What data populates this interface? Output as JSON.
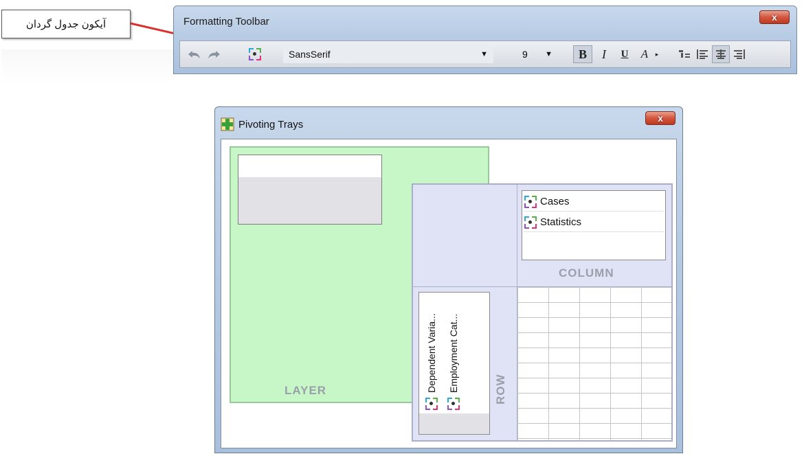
{
  "callout": {
    "text": "آیکون جدول گردان"
  },
  "formatting_toolbar": {
    "title": "Formatting Toolbar",
    "close_glyph": "x",
    "undo_icon": "undo-icon",
    "redo_icon": "redo-icon",
    "pivot_icon": "pivoting-trays-icon",
    "font_family": "SansSerif",
    "font_size": "9",
    "bold_label": "B",
    "italic_label": "I",
    "underline_label": "U",
    "text_color_label": "A",
    "align_icons": [
      "align-left-icon",
      "align-center-icon",
      "align-right-icon"
    ]
  },
  "pivot_window": {
    "title": "Pivoting Trays",
    "close_glyph": "x",
    "layer_label": "LAYER",
    "column_label": "COLUMN",
    "row_label": "ROW",
    "column_items": [
      "Cases",
      "Statistics"
    ],
    "row_items": [
      "Dependent Varia...",
      "Employment Cat..."
    ]
  },
  "colors": {
    "layer_green": "#c7f7c7",
    "pivot_lavender": "#e0e3f5",
    "arrow_red": "#d8302f"
  }
}
